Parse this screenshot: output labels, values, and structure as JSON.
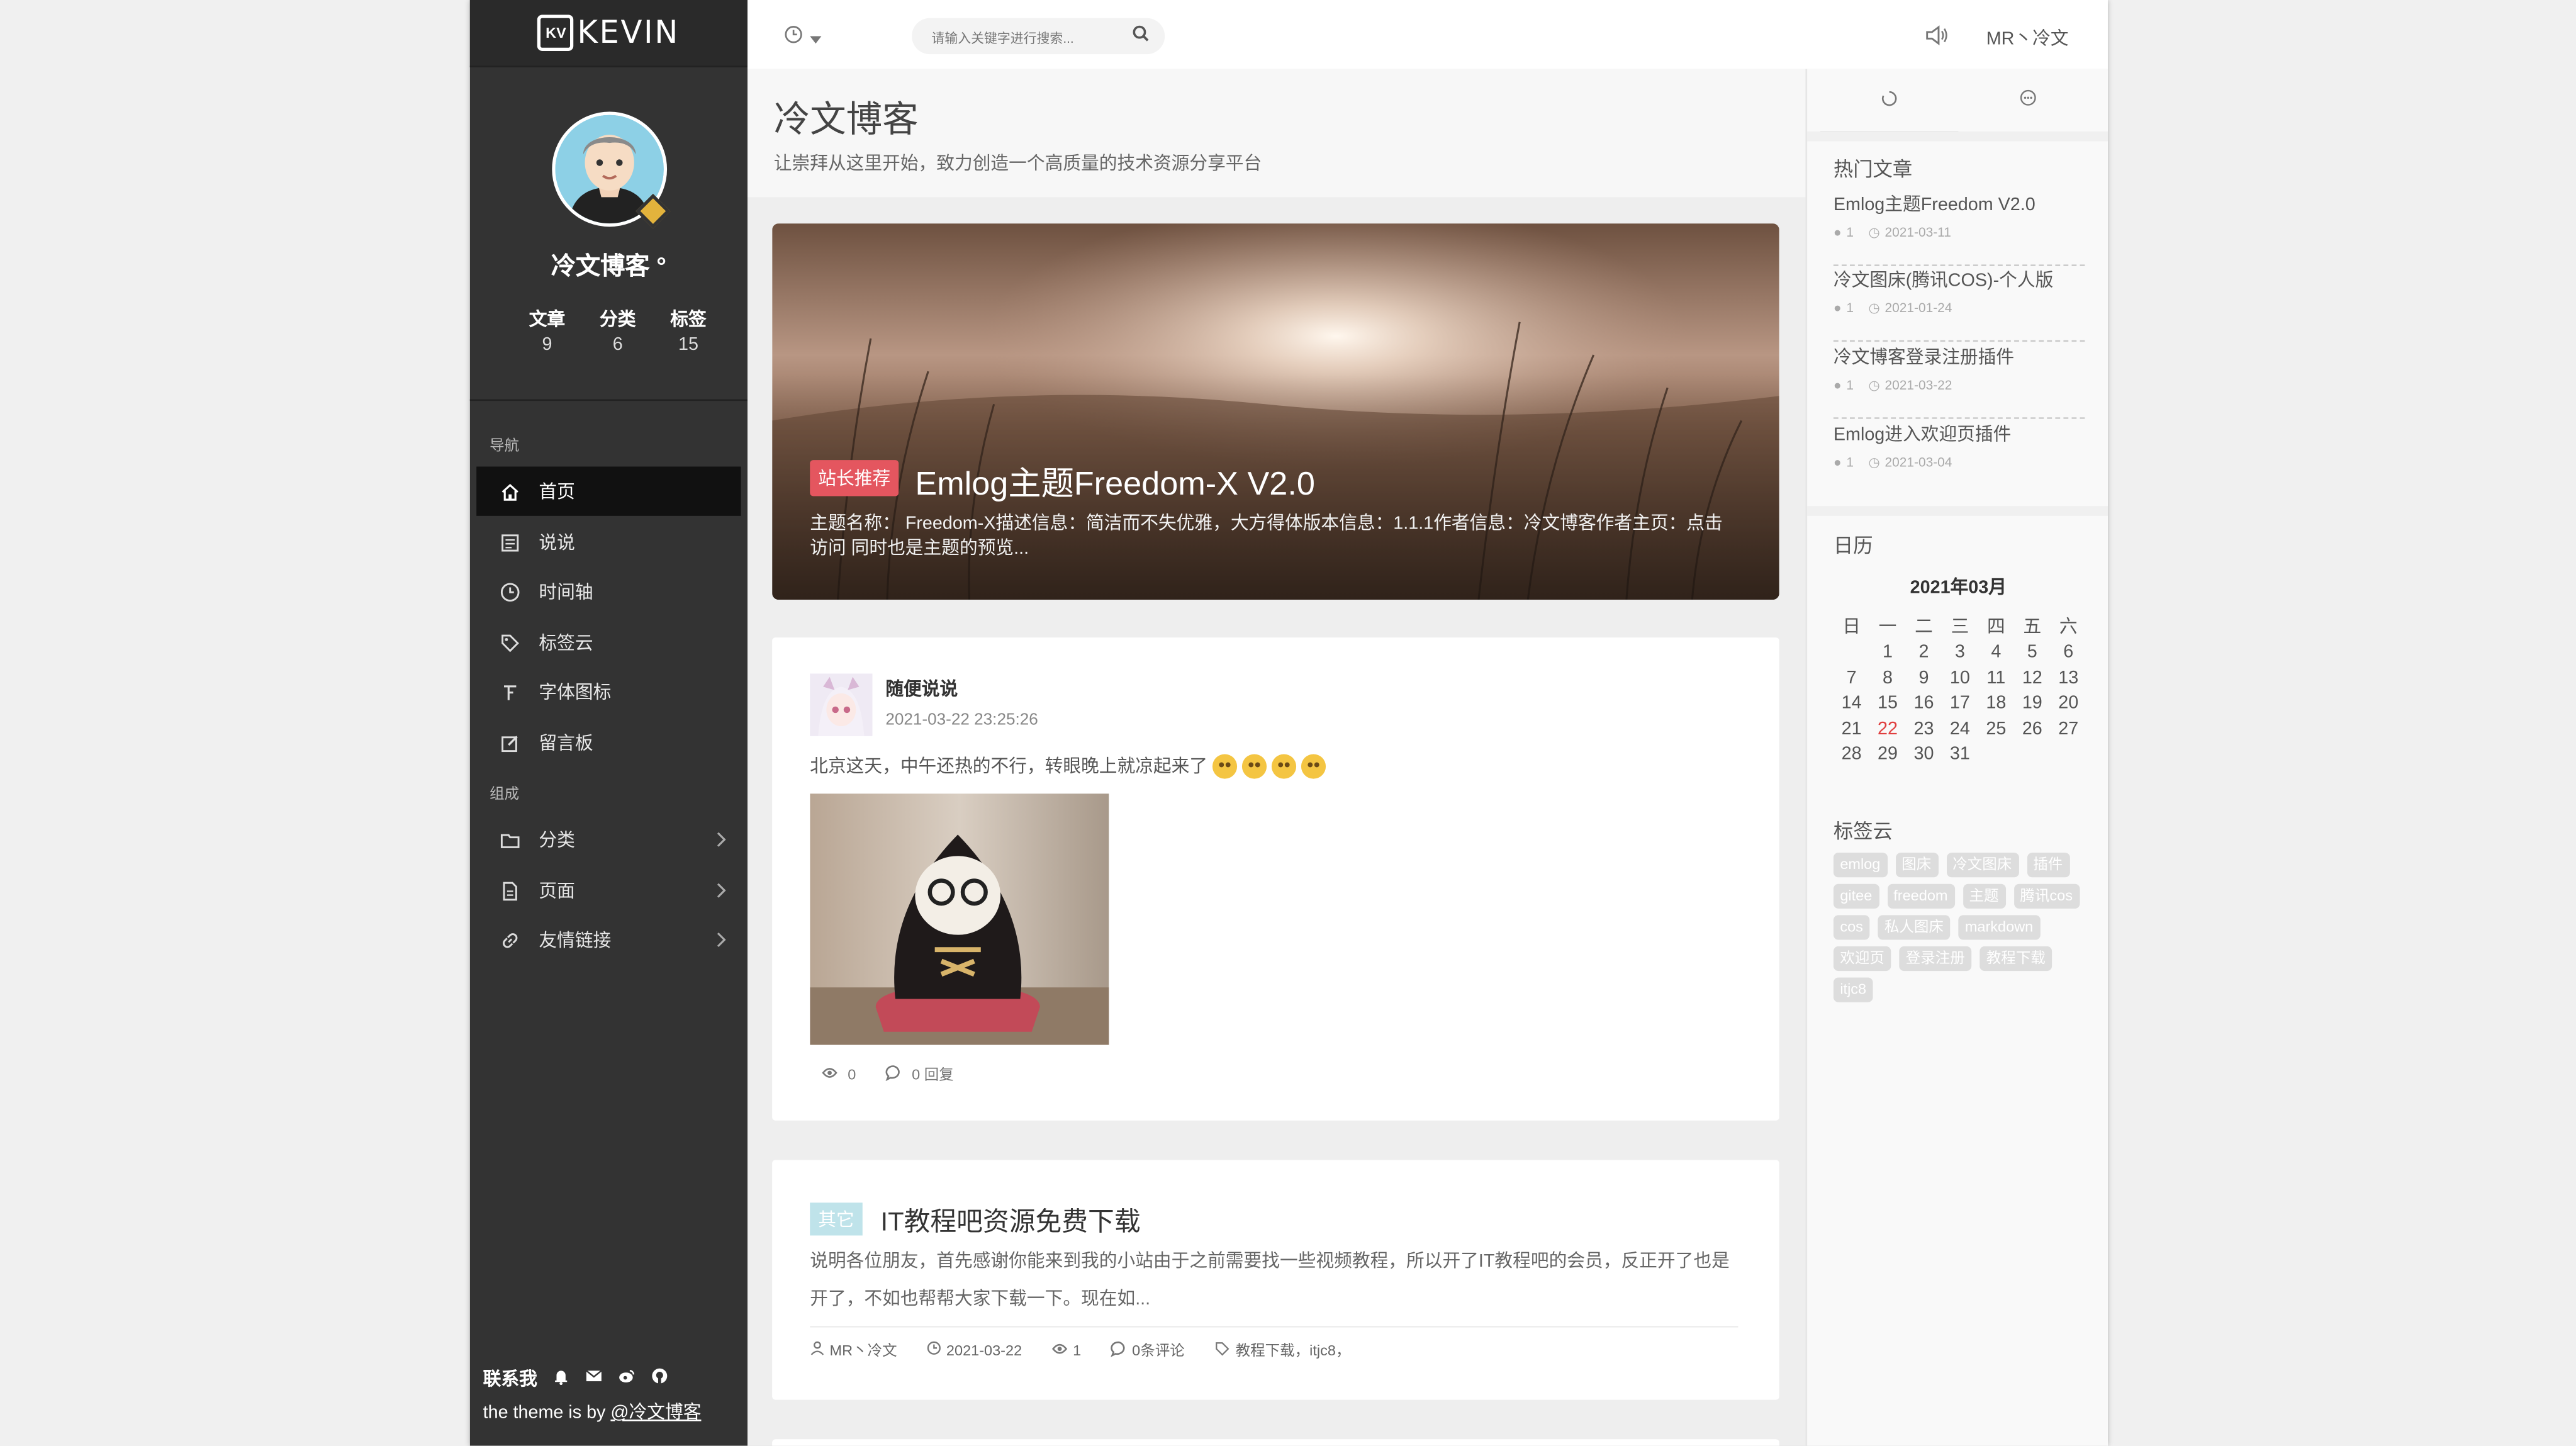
{
  "logo": {
    "mark": "KV",
    "text": "KEVIN"
  },
  "profile": {
    "name": "冷文博客 °"
  },
  "stats": [
    {
      "label": "文章",
      "value": "9"
    },
    {
      "label": "分类",
      "value": "6"
    },
    {
      "label": "标签",
      "value": "15"
    }
  ],
  "nav": {
    "head1": "导航",
    "items1": [
      {
        "label": "首页",
        "icon": "home-icon"
      },
      {
        "label": "说说",
        "icon": "note-icon"
      },
      {
        "label": "时间轴",
        "icon": "clock-icon"
      },
      {
        "label": "标签云",
        "icon": "tag-icon"
      },
      {
        "label": "字体图标",
        "icon": "font-icon"
      },
      {
        "label": "留言板",
        "icon": "edit-icon"
      }
    ],
    "head2": "组成",
    "items2": [
      {
        "label": "分类",
        "icon": "folder-icon"
      },
      {
        "label": "页面",
        "icon": "page-icon"
      },
      {
        "label": "友情链接",
        "icon": "link-icon"
      }
    ]
  },
  "footer": {
    "contact": "联系我",
    "credit_prefix": "the theme is by ",
    "credit_link": "@冷文博客"
  },
  "topbar": {
    "search_placeholder": "请输入关键字进行搜索...",
    "user": "MR丶冷文"
  },
  "page": {
    "title": "冷文博客",
    "subtitle": "让崇拜从这里开始，致力创造一个高质量的技术资源分享平台"
  },
  "hero": {
    "badge": "站长推荐",
    "title": "Emlog主题Freedom-X V2.0",
    "desc": "主题名称： Freedom-X描述信息：简洁而不失优雅，大方得体版本信息：1.1.1作者信息：冷文博客作者主页：点击访问 同时也是主题的预览..."
  },
  "post1": {
    "author": "随便说说",
    "time": "2021-03-22 23:25:26",
    "text": "北京这天，中午还热的不行，转眼晚上就凉起来了",
    "views": "0",
    "replies": "0 回复"
  },
  "post2": {
    "badge": "其它",
    "title": "IT教程吧资源免费下载",
    "desc": "说明各位朋友，首先感谢你能来到我的小站由于之前需要找一些视频教程，所以开了IT教程吧的会员，反正开了也是开了，不如也帮帮大家下载一下。现在如...",
    "author": "MR丶冷文",
    "date": "2021-03-22",
    "views": "1",
    "comments": "0条评论",
    "tags": "教程下载，itjc8，"
  },
  "hot": {
    "head": "热门文章",
    "items": [
      {
        "title": "Emlog主题Freedom V2.0",
        "views": "1",
        "date": "2021-03-11"
      },
      {
        "title": "冷文图床(腾讯COS)-个人版",
        "views": "1",
        "date": "2021-01-24"
      },
      {
        "title": "冷文博客登录注册插件",
        "views": "1",
        "date": "2021-03-22"
      },
      {
        "title": "Emlog进入欢迎页插件",
        "views": "1",
        "date": "2021-03-04"
      }
    ]
  },
  "calendar": {
    "head": "日历",
    "month": "2021年03月",
    "weekdays": [
      "日",
      "一",
      "二",
      "三",
      "四",
      "五",
      "六"
    ],
    "leading_blanks": 1,
    "days": 31,
    "today": 22
  },
  "tagcloud": {
    "head": "标签云",
    "tags": [
      "emlog",
      "图床",
      "冷文图床",
      "插件",
      "gitee",
      "freedom",
      "主题",
      "腾讯cos",
      "cos",
      "私人图床",
      "markdown",
      "欢迎页",
      "登录注册",
      "教程下载",
      "itjc8"
    ]
  }
}
